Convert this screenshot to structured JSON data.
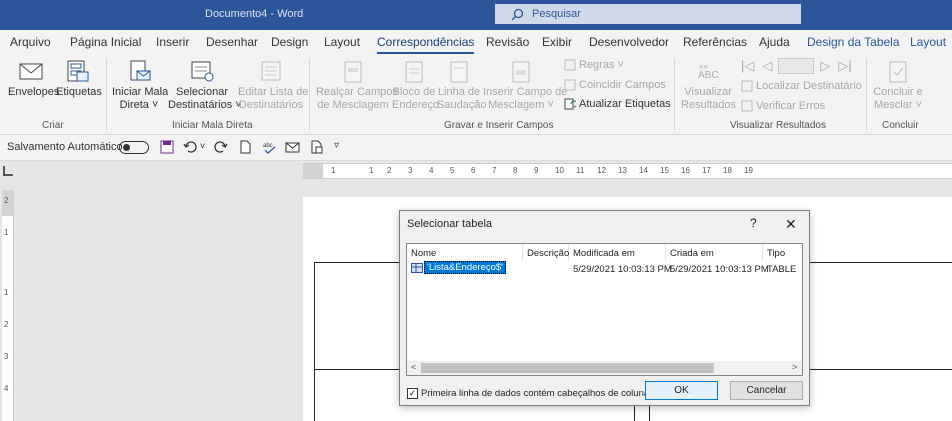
{
  "titlebar": {
    "doc_title": "Documento4  -  Word",
    "search_placeholder": "Pesquisar"
  },
  "tabs": [
    {
      "label": "Arquivo"
    },
    {
      "label": "Página Inicial"
    },
    {
      "label": "Inserir"
    },
    {
      "label": "Desenhar"
    },
    {
      "label": "Design"
    },
    {
      "label": "Layout"
    },
    {
      "label": "Correspondências"
    },
    {
      "label": "Revisão"
    },
    {
      "label": "Exibir"
    },
    {
      "label": "Desenvolvedor"
    },
    {
      "label": "Referências"
    },
    {
      "label": "Ajuda"
    },
    {
      "label": "Design da Tabela"
    },
    {
      "label": "Layout"
    }
  ],
  "ribbon": {
    "envelopes": "Envelopes",
    "etiquetas": "Etiquetas",
    "iniciar_mala": "Iniciar Mala",
    "direta": "Direta",
    "selecionar": "Selecionar",
    "destinatarios": "Destinatários",
    "editar_lista": "Editar Lista de",
    "destinatarios2": "Destinatários",
    "realcar": "Realçar Campos",
    "de_mesclagem": "de Mesclagem",
    "bloco": "Bloco de",
    "endereco": "Endereço",
    "linha": "Linha de",
    "saudacao": "Saudação",
    "inserir_campo": "Inserir Campo de",
    "mesclagem": "Mesclagem",
    "regras": "Regras",
    "coincidir": "Coincidir Campos",
    "atualizar": "Atualizar Etiquetas",
    "visualizar": "Visualizar",
    "resultados": "Resultados",
    "localizar": "Localizar Destinatário",
    "verificar": "Verificar Erros",
    "concluir": "Concluir e",
    "mesclar": "Mesclar",
    "group_criar": "Criar",
    "group_iniciar": "Iniciar Mala Direta",
    "group_gravar": "Gravar e Inserir Campos",
    "group_visualizar": "Visualizar Resultados",
    "group_concluir": "Concluir"
  },
  "qat": {
    "autosave_label": "Salvamento Automático"
  },
  "ruler": {
    "h_numbers": [
      "1",
      "1",
      "2",
      "3",
      "4",
      "5",
      "6",
      "7",
      "8",
      "9",
      "10",
      "11",
      "12",
      "13",
      "14",
      "15",
      "16",
      "17",
      "18",
      "19"
    ],
    "v_numbers": [
      "2",
      "1",
      "1",
      "2",
      "3",
      "4"
    ]
  },
  "dialog": {
    "title": "Selecionar tabela",
    "help": "?",
    "close": "✕",
    "columns": [
      "Nome",
      "Descrição",
      "Modificada em",
      "Criada em",
      "Tipo"
    ],
    "rows": [
      {
        "name": "'Lista&Endereço$'",
        "description": "",
        "modified": "5/29/2021 10:03:13 PM",
        "created": "5/29/2021 10:03:13 PM",
        "type": "TABLE"
      }
    ],
    "checkbox_label": "Primeira linha de dados contém cabeçalhos de coluna",
    "checkbox_checked": true,
    "ok_label": "OK",
    "cancel_label": "Cancelar"
  },
  "colors": {
    "titlebar": "#2b579a",
    "accent": "#0078d7"
  }
}
